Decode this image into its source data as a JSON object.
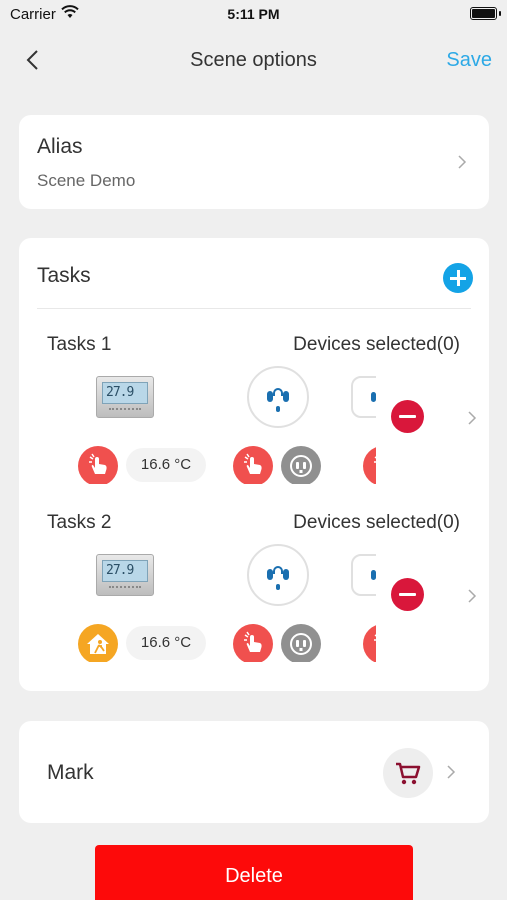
{
  "status_bar": {
    "carrier": "Carrier",
    "time": "5:11 PM"
  },
  "nav": {
    "title": "Scene options",
    "save_label": "Save",
    "back_icon": "chevron-left-icon"
  },
  "alias": {
    "label": "Alias",
    "value": "Scene Demo"
  },
  "tasks": {
    "heading": "Tasks",
    "items": [
      {
        "name": "Tasks 1",
        "devices_selected": "Devices selected(0)",
        "temperature": "16.6 °C",
        "thermostat_display": "27.9 6.6",
        "triggers": [
          "touch-trigger-icon",
          "touch-trigger-icon",
          "socket-trigger-icon",
          "touch-trigger-icon"
        ]
      },
      {
        "name": "Tasks 2",
        "devices_selected": "Devices selected(0)",
        "temperature": "16.6 °C",
        "thermostat_display": "27.9 6.6",
        "triggers": [
          "home-away-trigger-icon",
          "touch-trigger-icon",
          "socket-trigger-icon",
          "touch-trigger-icon"
        ]
      }
    ]
  },
  "mark": {
    "label": "Mark",
    "icon": "cart-icon"
  },
  "delete_label": "Delete",
  "colors": {
    "accent": "#14a3e6",
    "save": "#2da9e6",
    "trigger_red": "#f0504e",
    "trigger_orange": "#f5a623",
    "remove": "#d9173b",
    "delete": "#fd0a0a",
    "background": "#efefef"
  }
}
